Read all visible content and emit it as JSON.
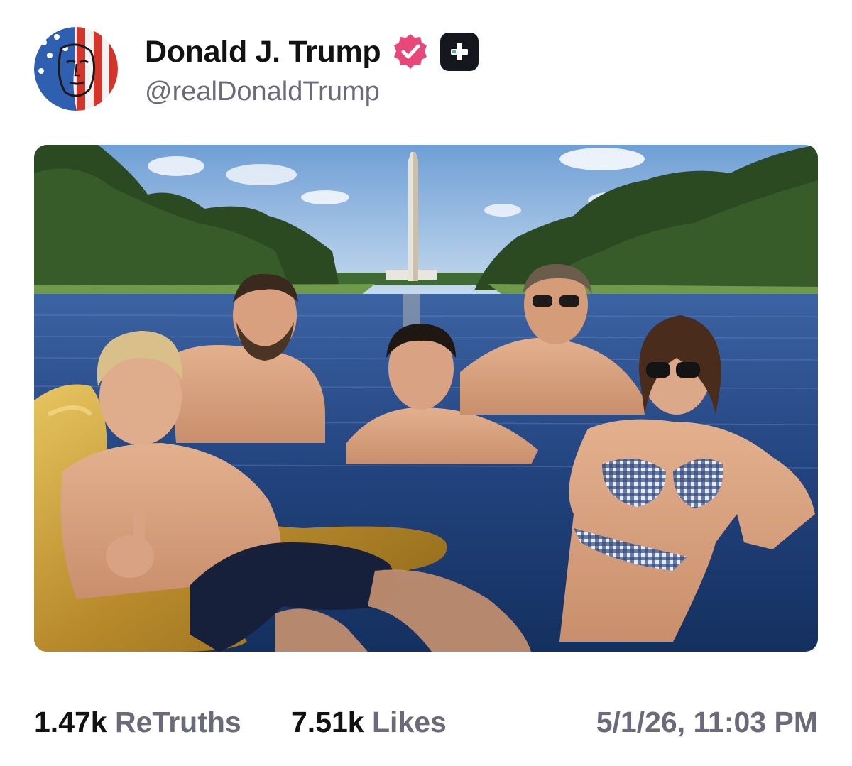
{
  "post": {
    "author": {
      "display_name": "Donald J. Trump",
      "handle": "@realDonaldTrump",
      "verified_icon": "verified-check-icon",
      "plus_icon": "truth-plus-icon",
      "avatar_icon": "flag-portrait-avatar"
    },
    "media": {
      "type": "image",
      "subject": "five-people-in-reflecting-pool-with-washington-monument"
    },
    "stats": {
      "retruths_count": "1.47k",
      "retruths_label": "ReTruths",
      "likes_count": "7.51k",
      "likes_label": "Likes"
    },
    "timestamp": "5/1/26, 11:03 PM"
  },
  "colors": {
    "verified_badge": "#e8477a",
    "plus_badge_bg": "#15171e",
    "secondary_text": "#6b6a7a",
    "primary_text": "#121212"
  }
}
